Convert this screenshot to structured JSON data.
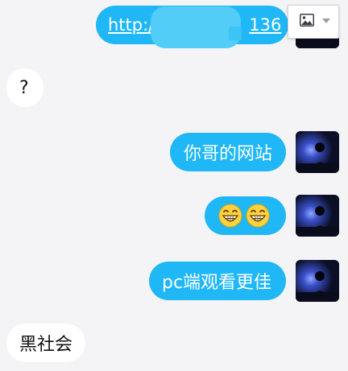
{
  "messages": [
    {
      "direction": "outgoing",
      "type": "link",
      "link_prefix": "http:/",
      "link_suffix": "136"
    },
    {
      "direction": "incoming",
      "type": "text",
      "text": "?"
    },
    {
      "direction": "outgoing",
      "type": "text",
      "text": "你哥的网站"
    },
    {
      "direction": "outgoing",
      "type": "emoji",
      "emojis": [
        "grinning-face-icon",
        "grinning-face-icon"
      ]
    },
    {
      "direction": "outgoing",
      "type": "text",
      "text": "pc端观看更佳"
    },
    {
      "direction": "incoming",
      "type": "text",
      "text": "黑社会"
    }
  ],
  "image_badge": {
    "icon": "image-icon",
    "dropdown_icon": "chevron-down-icon"
  },
  "colors": {
    "outgoing_bubble": "#1fb7f6",
    "incoming_bubble": "#ffffff",
    "background": "#f4f4f6",
    "avatar_background": "#0b0f26"
  }
}
